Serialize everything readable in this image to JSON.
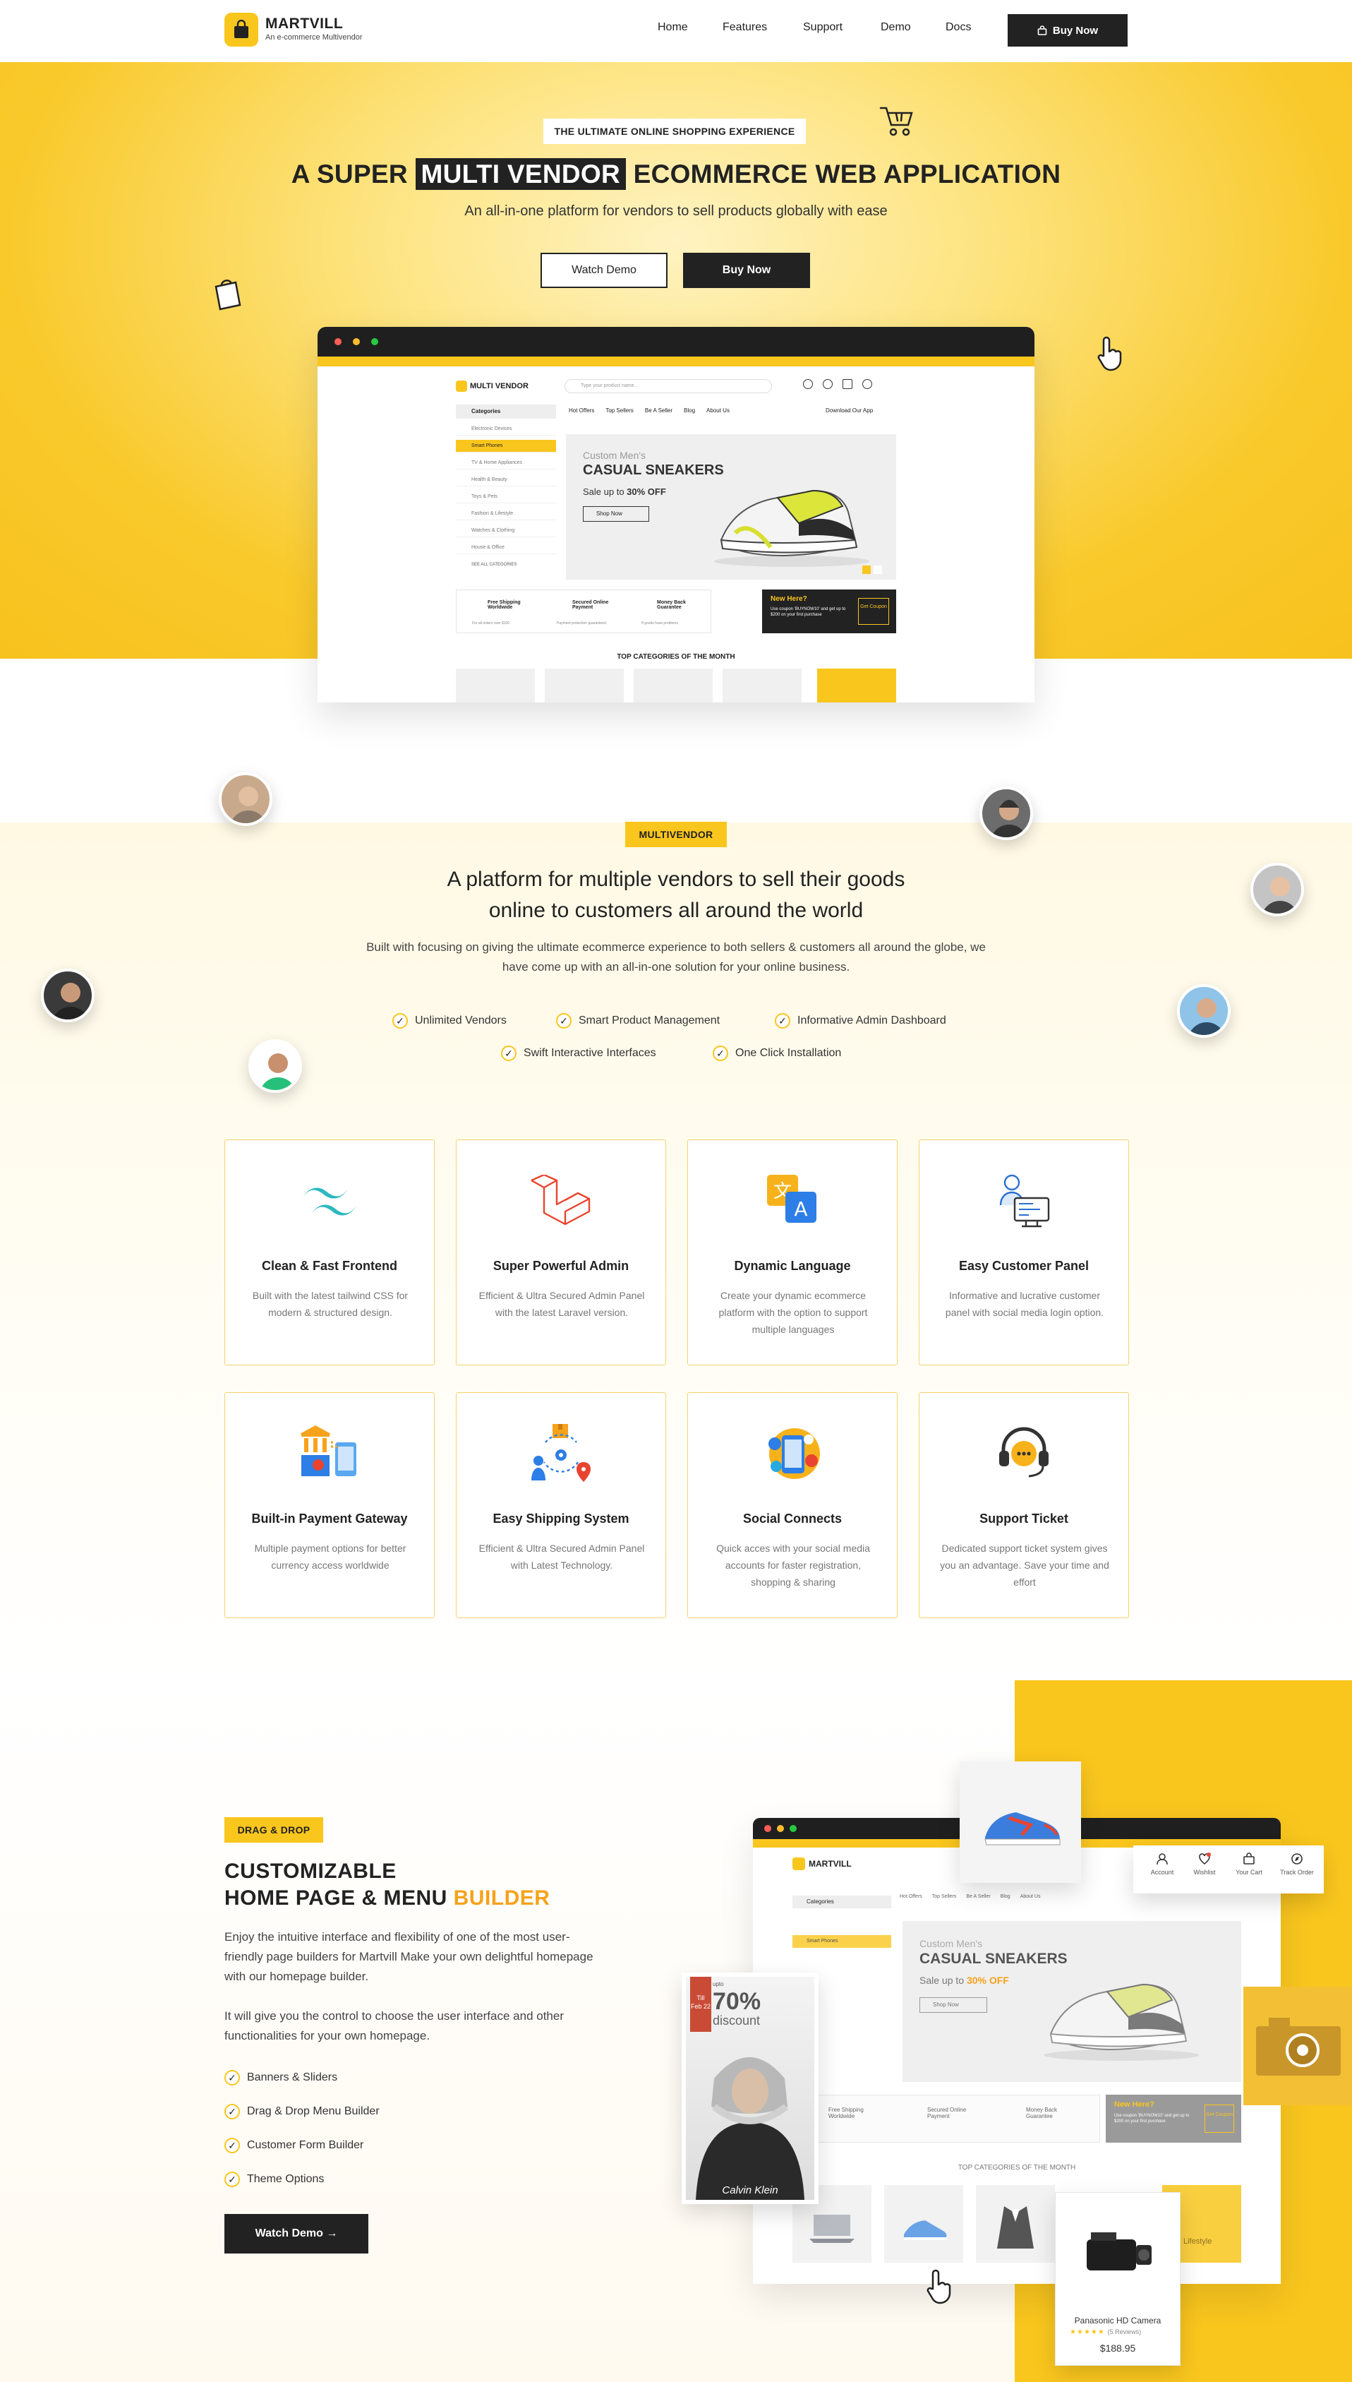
{
  "nav": {
    "brand": "MARTVILL",
    "brand_sub": "An e-commerce Multivendor",
    "links": [
      "Home",
      "Features",
      "Support",
      "Demo",
      "Docs"
    ],
    "buy_label": "Buy Now"
  },
  "hero": {
    "eyebrow": "THE ULTIMATE ONLINE SHOPPING EXPERIENCE",
    "title_pre": "A SUPER",
    "title_hl": "MULTI VENDOR",
    "title_post": "ECOMMERCE WEB APPLICATION",
    "subtitle": "An all-in-one platform for vendors to sell products globally with ease",
    "watch_demo": "Watch Demo",
    "buy_now": "Buy Now"
  },
  "mock": {
    "brand": "MULTI VENDOR",
    "search_placeholder": "Type your product name...",
    "categories_label": "Categories",
    "categories": [
      "Electronic Devices",
      "Smart Phones",
      "TV & Home Appliances",
      "Health & Beauty",
      "Toys & Pets",
      "Fashion & Lifestyle",
      "Watches & Clothing",
      "House & Office"
    ],
    "see_all": "SEE ALL CATEGORIES",
    "menu": [
      "Hot Offers",
      "Top Sellers",
      "Be A Seller",
      "Blog",
      "About Us"
    ],
    "download_app": "Download Our App",
    "banner_kicker": "Custom Men's",
    "banner_title": "CASUAL SNEAKERS",
    "banner_sale_pre": "Sale up to",
    "banner_sale_pct": "30% OFF",
    "banner_btn": "Shop Now",
    "features": [
      {
        "title": "Free Shipping Worldwide",
        "sub": "For all orders over $100"
      },
      {
        "title": "Secured Online Payment",
        "sub": "Payment protection guaranteed"
      },
      {
        "title": "Money Back Guarantee",
        "sub": "If goods have problems"
      }
    ],
    "promo_title": "New Here?",
    "promo_text": "Use coupon 'BUYNOW10' and get up to $200 on your first purchase",
    "promo_btn": "Get Coupon",
    "top_categories": "TOP CATEGORIES OF THE MONTH",
    "lifestyle": "Lifestyle"
  },
  "section2": {
    "tag": "MULTIVENDOR",
    "title_line1": "A platform for multiple vendors to sell their goods",
    "title_line2": "online to customers all around the world",
    "desc": "Built with focusing on giving the ultimate ecommerce experience to both sellers & customers all around the globe, we have come up with an all-in-one solution for your online business.",
    "checks": [
      "Unlimited Vendors",
      "Smart Product Management",
      "Informative Admin Dashboard",
      "Swift Interactive Interfaces",
      "One Click Installation"
    ],
    "cards": [
      {
        "title": "Clean & Fast Frontend",
        "desc": "Built with the latest tailwind CSS for modern & structured design."
      },
      {
        "title": "Super Powerful Admin",
        "desc": "Efficient & Ultra Secured Admin Panel with the latest Laravel version."
      },
      {
        "title": "Dynamic Language",
        "desc": "Create your dynamic ecommerce platform with the option to support multiple languages"
      },
      {
        "title": "Easy Customer Panel",
        "desc": "Informative and lucrative customer panel with social media login option."
      },
      {
        "title": "Built-in Payment Gateway",
        "desc": "Multiple payment options for better currency access worldwide"
      },
      {
        "title": "Easy Shipping System",
        "desc": "Efficient & Ultra Secured Admin Panel with Latest Technology."
      },
      {
        "title": "Social Connects",
        "desc": "Quick acces with your social media accounts for faster registration, shopping & sharing"
      },
      {
        "title": "Support Ticket",
        "desc": "Dedicated support ticket system gives you an advantage. Save your time and effort"
      }
    ]
  },
  "section3": {
    "tag": "DRAG & DROP",
    "title_line1": "CUSTOMIZABLE",
    "title_line2_pre": "HOME PAGE & MENU",
    "title_line2_hl": "BUILDER",
    "p1": "Enjoy the intuitive interface and flexibility of one of the most user-friendly page builders for Martvill Make your own delightful homepage with our homepage builder.",
    "p2": "It will give you the control to choose the user interface and other functionalities for your own homepage.",
    "checks": [
      "Banners & Sliders",
      "Drag & Drop Menu Builder",
      "Customer Form Builder",
      "Theme Options"
    ],
    "demo_btn": "Watch Demo →",
    "mock_brand": "MARTVILL",
    "account_items": [
      "Account",
      "Wishlist",
      "Your Cart",
      "Track Order"
    ],
    "promo_till": "Till",
    "promo_date": "Feb 22",
    "promo_upto": "upto",
    "promo_pct": "70%",
    "promo_discount": "discount",
    "promo_brand": "Calvin Klein",
    "product_name": "Panasonic HD Camera",
    "product_reviews": "(5 Reviews)",
    "product_price": "$188.95",
    "product_rating": 5
  },
  "colors": {
    "accent": "#f9c61e",
    "dark": "#222222",
    "orange": "#f7a21b"
  }
}
